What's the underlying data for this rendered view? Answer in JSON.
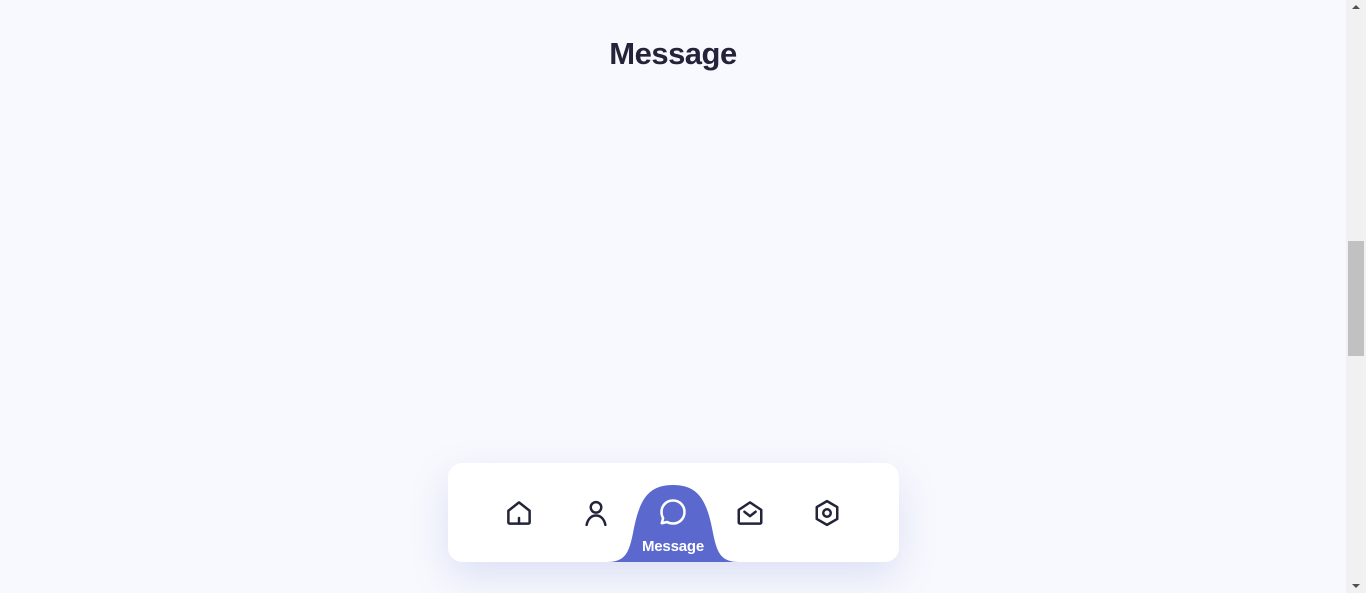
{
  "page": {
    "title": "Message"
  },
  "nav": {
    "active_label": "Message",
    "items": [
      {
        "icon": "home-icon"
      },
      {
        "icon": "user-icon"
      },
      {
        "icon": "chat-bubble-icon"
      },
      {
        "icon": "envelope-open-icon"
      },
      {
        "icon": "hexagon-settings-icon"
      }
    ],
    "active_index": 2
  },
  "colors": {
    "background": "#f8f9fe",
    "accent": "#5b68ce",
    "text": "#23233a",
    "nav_background": "#ffffff"
  }
}
